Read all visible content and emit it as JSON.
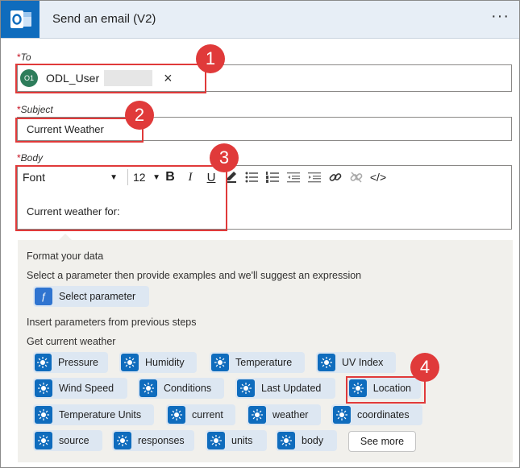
{
  "header": {
    "title": "Send an email (V2)",
    "more_label": "···"
  },
  "to": {
    "label": "To",
    "required_mark": "*",
    "avatar_text": "O1",
    "user": "ODL_User",
    "remove": "×"
  },
  "subject": {
    "label": "Subject",
    "required_mark": "*",
    "value": "Current Weather"
  },
  "body": {
    "label": "Body",
    "required_mark": "*",
    "value": "Current weather for:",
    "toolbar": {
      "font": "Font",
      "size": "12",
      "bold": "B",
      "italic": "I",
      "underline": "U",
      "code": "</>"
    }
  },
  "format_panel": {
    "title": "Format your data",
    "hint": "Select a parameter then provide examples and we'll suggest an expression",
    "select_parameter": "Select parameter",
    "insert_label": "Insert parameters from previous steps",
    "group_label": "Get current weather",
    "chips": [
      "Pressure",
      "Humidity",
      "Temperature",
      "UV Index",
      "Wind Speed",
      "Conditions",
      "Last Updated",
      "Location",
      "Temperature Units",
      "current",
      "weather",
      "coordinates",
      "source",
      "responses",
      "units",
      "body"
    ],
    "see_more": "See more"
  },
  "callouts": [
    "1",
    "2",
    "3",
    "4"
  ],
  "colors": {
    "accent": "#0f6cbd",
    "callout": "#e03a3a",
    "panel": "#f1f0ec",
    "chip": "#dde7f2"
  },
  "icons": {
    "app": "outlook-icon",
    "chip": "weather-sun-icon",
    "expression": "expression-icon"
  }
}
